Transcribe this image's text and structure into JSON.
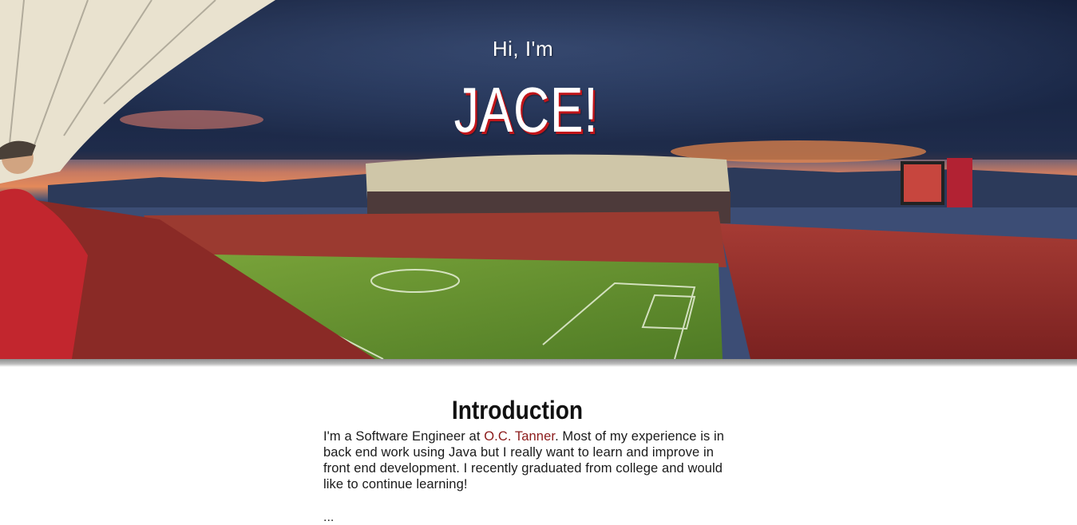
{
  "hero": {
    "greeting": "Hi, I'm",
    "name": "JACE!",
    "image": "stadium-panorama"
  },
  "intro": {
    "title": "Introduction",
    "text_before_link": "I'm a Software Engineer at ",
    "link_text": "O.C. Tanner",
    "text_after_link": ". Most of my experience is in back end work using Java but I really want to learn and improve in front end development. I recently graduated from college and would like to continue learning!"
  },
  "next_section_hint": "..."
}
